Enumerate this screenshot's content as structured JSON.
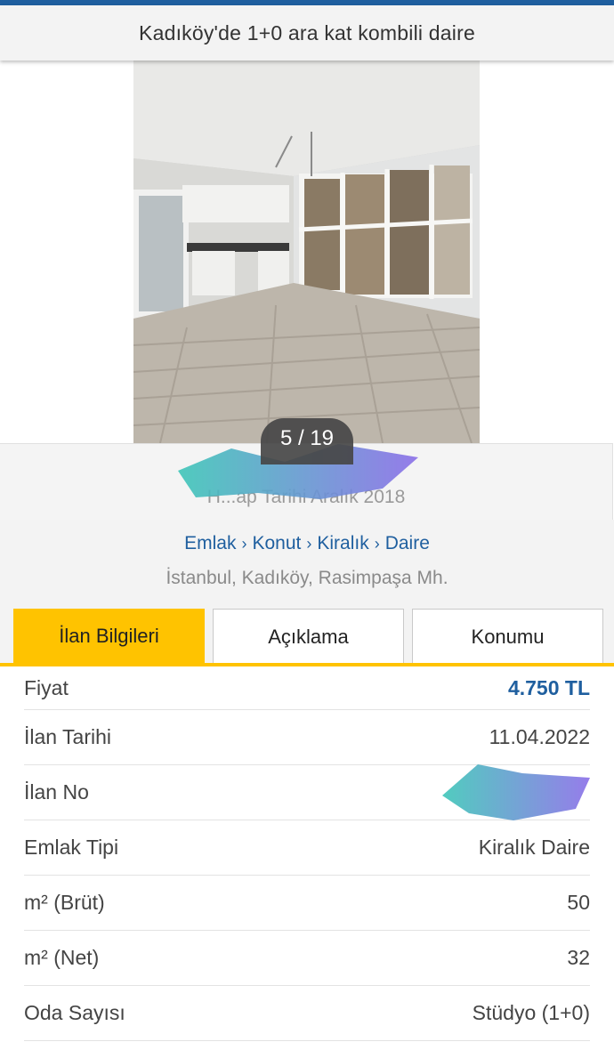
{
  "header": {
    "title": "Kadıköy'de 1+0 ara kat kombili daire"
  },
  "gallery": {
    "counter": "5 / 19"
  },
  "seller": {
    "since_text": "H...ap Tarihi Aralık 2018"
  },
  "breadcrumb": {
    "items": [
      "Emlak",
      "Konut",
      "Kiralık",
      "Daire"
    ],
    "location": "İstanbul, Kadıköy, Rasimpaşa Mh."
  },
  "tabs": [
    {
      "label": "İlan Bilgileri"
    },
    {
      "label": "Açıklama"
    },
    {
      "label": "Konumu"
    }
  ],
  "details": [
    {
      "label": "Fiyat",
      "value": "4.750 TL"
    },
    {
      "label": "İlan Tarihi",
      "value": "11.04.2022"
    },
    {
      "label": "İlan No",
      "value": ""
    },
    {
      "label": "Emlak Tipi",
      "value": "Kiralık Daire"
    },
    {
      "label": "m² (Brüt)",
      "value": "50"
    },
    {
      "label": "m² (Net)",
      "value": "32"
    },
    {
      "label": "Oda Sayısı",
      "value": "Stüdyo (1+0)"
    }
  ],
  "colors": {
    "brand_blue": "#1f5f9f",
    "active_tab": "#ffc300",
    "redaction": "#4fb8b8"
  }
}
